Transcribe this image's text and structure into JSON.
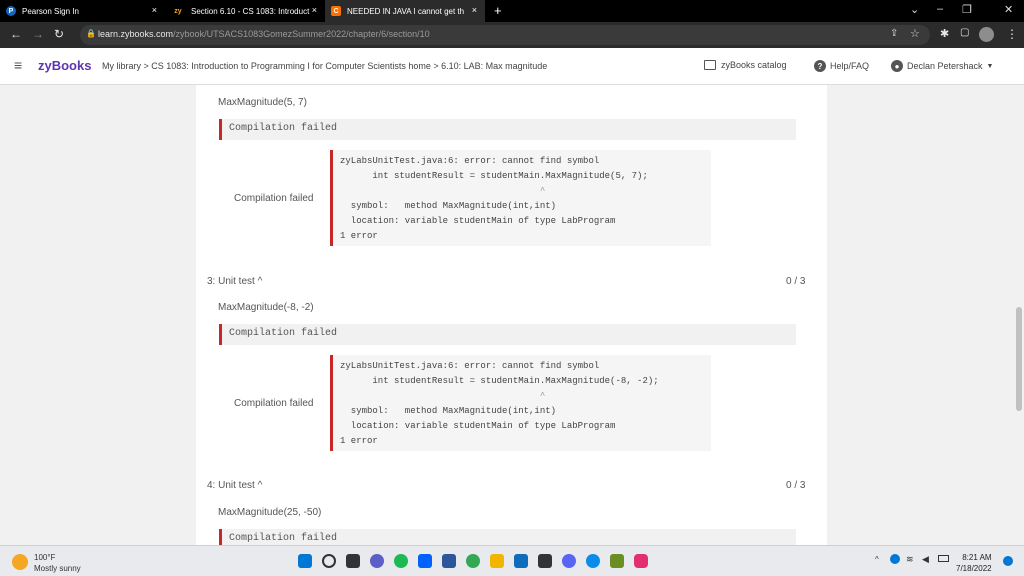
{
  "tabs": [
    {
      "label": "Pearson Sign In",
      "close": "×"
    },
    {
      "label": "Section 6.10 - CS 1083: Introduct",
      "close": "×"
    },
    {
      "label": "NEEDED IN JAVA I cannot get th",
      "close": "×"
    }
  ],
  "new_tab": "+",
  "address": {
    "host": "learn.zybooks.com",
    "path": "/zybook/UTSACS1083GomezSummer2022/chapter/6/section/10"
  },
  "header": {
    "logo": "zyBooks",
    "breadcrumb": "My library > CS 1083: Introduction to Programming I for Computer Scientists home > 6.10: LAB: Max magnitude",
    "catalog": "zyBooks catalog",
    "help": "Help/FAQ",
    "user": "Declan Petershack"
  },
  "tests": [
    {
      "header": "",
      "score": "",
      "input": "MaxMagnitude(5, 7)",
      "failed_label": "Compilation failed",
      "side_label": "Compilation failed",
      "error_lines": [
        "zyLabsUnitTest.java:6: error: cannot find symbol",
        "      int studentResult = studentMain.MaxMagnitude(5, 7);",
        "                                     ^",
        "  symbol:   method MaxMagnitude(int,int)",
        "  location: variable studentMain of type LabProgram",
        "1 error"
      ]
    },
    {
      "header": "3: Unit test ^",
      "score": "0 / 3",
      "input": "MaxMagnitude(-8, -2)",
      "failed_label": "Compilation failed",
      "side_label": "Compilation failed",
      "error_lines": [
        "zyLabsUnitTest.java:6: error: cannot find symbol",
        "      int studentResult = studentMain.MaxMagnitude(-8, -2);",
        "                                     ^",
        "  symbol:   method MaxMagnitude(int,int)",
        "  location: variable studentMain of type LabProgram",
        "1 error"
      ]
    },
    {
      "header": "4: Unit test ^",
      "score": "0 / 3",
      "input": "MaxMagnitude(25, -50)",
      "failed_label": "Compilation failed"
    }
  ],
  "weather": {
    "temp": "100°F",
    "desc": "Mostly sunny"
  },
  "clock": {
    "time": "8:21 AM",
    "date": "7/18/2022"
  }
}
